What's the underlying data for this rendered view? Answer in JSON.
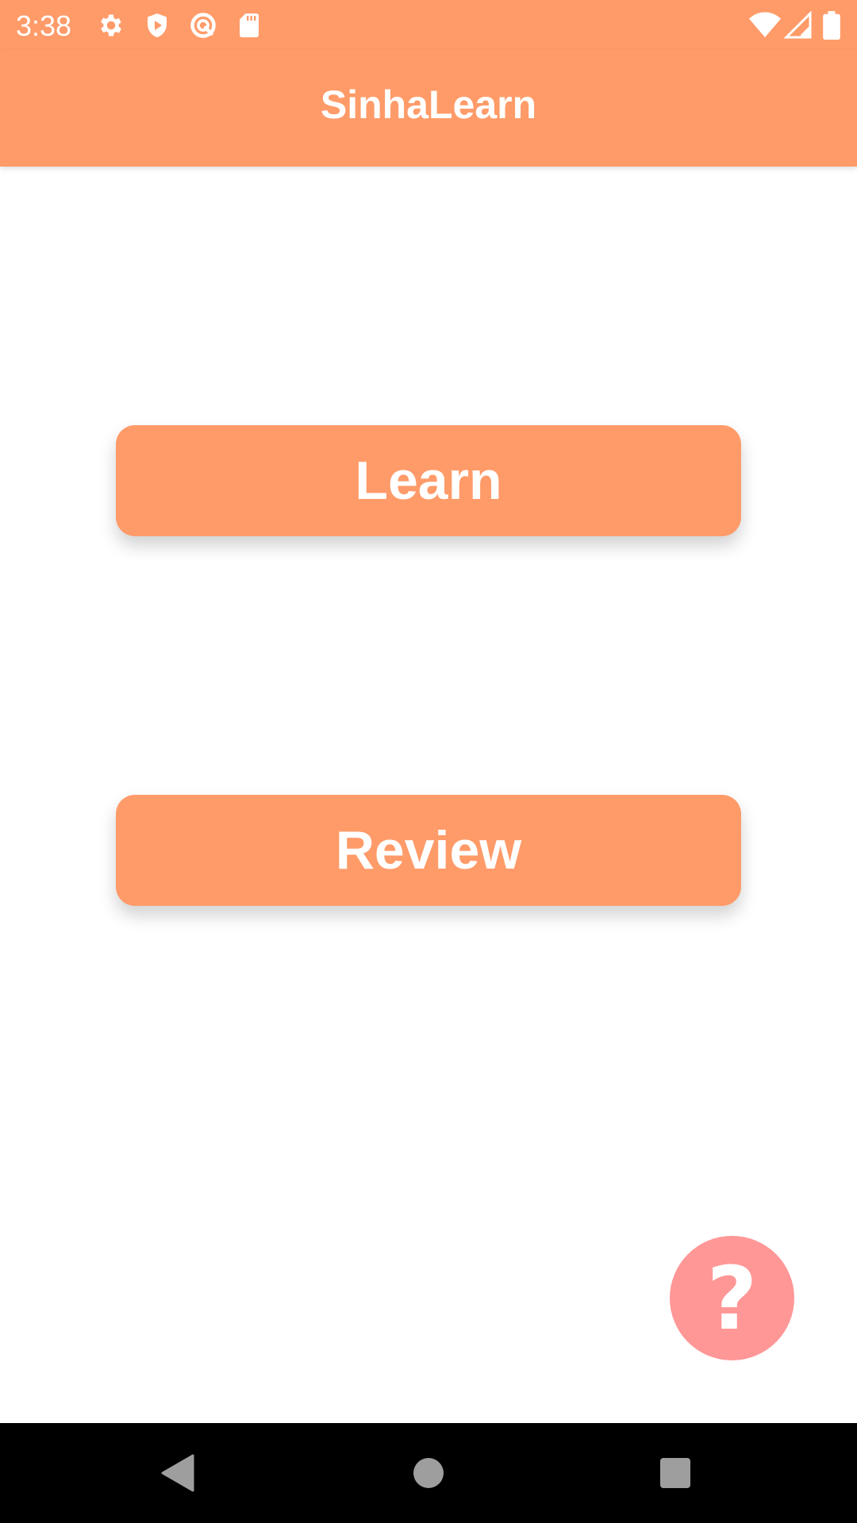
{
  "status_bar": {
    "time": "3:38",
    "left_icons": [
      "gear-icon",
      "shield-play-icon",
      "sync-circle-icon",
      "sd-card-icon"
    ],
    "right_icons": [
      "wifi-icon",
      "cell-signal-icon",
      "battery-icon"
    ]
  },
  "app_bar": {
    "title": "SinhaLearn"
  },
  "main": {
    "learn_label": "Learn",
    "review_label": "Review"
  },
  "fab": {
    "glyph": "?",
    "icon": "help-icon"
  },
  "nav_bar": {
    "icons": [
      "back-icon",
      "home-icon",
      "recents-icon"
    ]
  },
  "colors": {
    "accent": "#ff9b69",
    "fab": "#ff9797",
    "background": "#ffffff",
    "nav_bar": "#000000"
  }
}
